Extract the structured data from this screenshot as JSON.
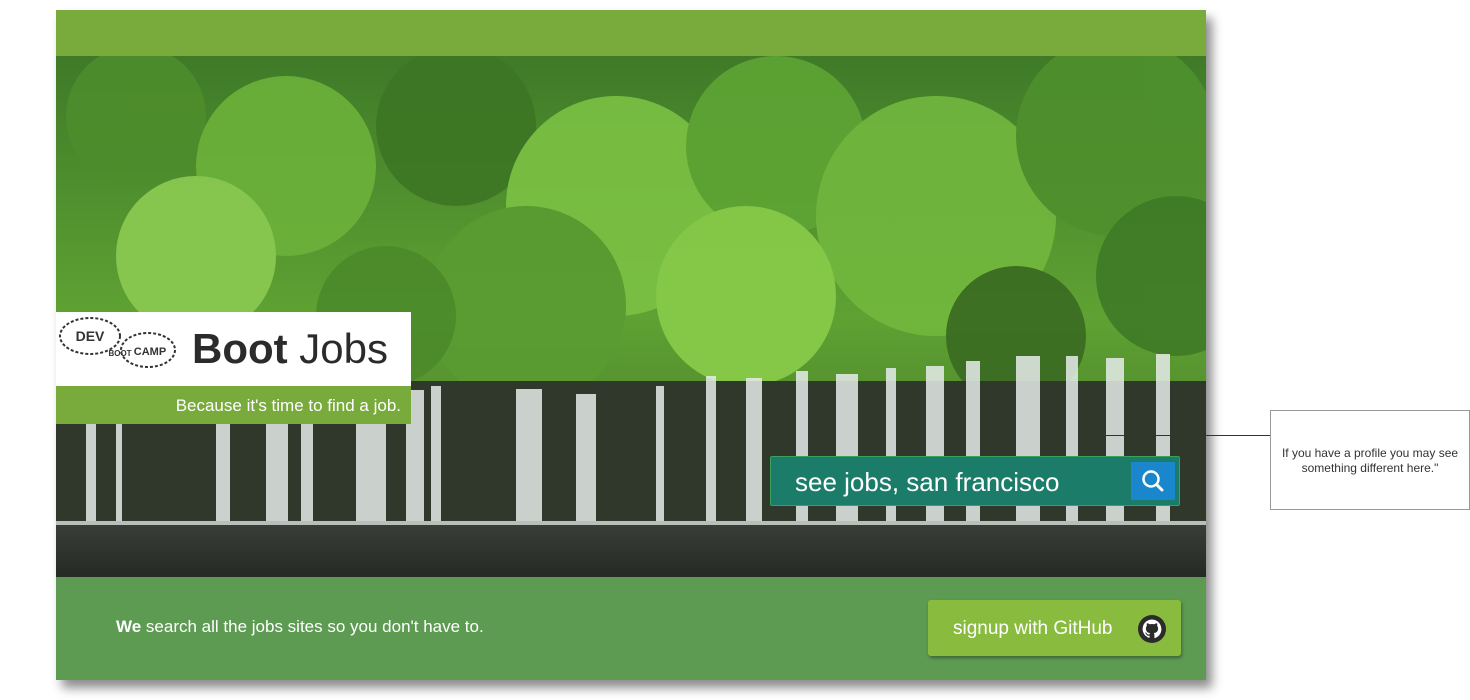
{
  "logo": {
    "bold_word": "Boot",
    "word": " Jobs",
    "tagline": "Because it's time to find a job.",
    "mark_text": [
      "DEV",
      "BOOT",
      "CAMP"
    ],
    "mark_icon": "bootprint-logo-icon"
  },
  "search": {
    "placeholder": "see jobs, san francisco",
    "button_icon": "search-icon"
  },
  "footer": {
    "emphasis": "We",
    "text": " search all the jobs sites so you don't have to.",
    "signup_label": "signup with GitHub",
    "signup_icon": "github-icon"
  },
  "annotation": {
    "text": "If you have a profile you may see something different here.\""
  },
  "colors": {
    "topbar": "#78ab3c",
    "footer": "#5d9b53",
    "signup_button": "#88bb3e",
    "search_bar": "#1b7c6a",
    "search_button": "#1a86cc"
  },
  "background_image": "forest waterfall photograph"
}
